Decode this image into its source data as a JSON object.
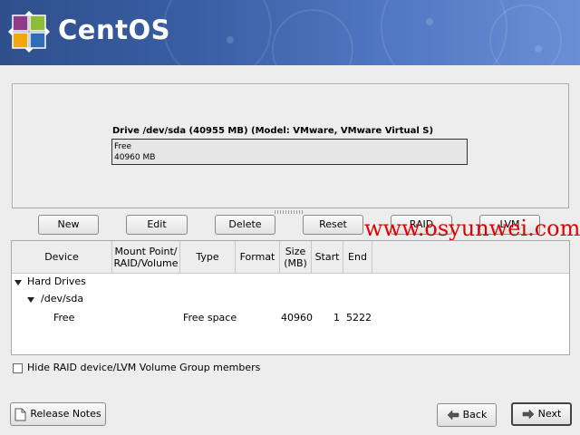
{
  "header": {
    "brand": "CentOS",
    "colors": {
      "banner": "#3a5fa5",
      "logo_green": "#8bbd3a",
      "logo_purple": "#8e3b8c",
      "logo_orange": "#f2a70f",
      "logo_blue": "#2f6db5"
    }
  },
  "drive": {
    "label": "Drive /dev/sda (40955 MB) (Model: VMware, VMware Virtual S)",
    "segment_name": "Free",
    "segment_size": "40960 MB"
  },
  "buttons": {
    "new": "New",
    "edit": "Edit",
    "delete": "Delete",
    "reset": "Reset",
    "raid": "RAID",
    "lvm": "LVM"
  },
  "watermark": "www.osyunwei.com",
  "table": {
    "columns": [
      "Device",
      "Mount Point/ RAID/Volume",
      "Type",
      "Format",
      "Size (MB)",
      "Start",
      "End"
    ],
    "columns_display": {
      "device": "Device",
      "mount_line1": "Mount Point/",
      "mount_line2": "RAID/Volume",
      "type": "Type",
      "format": "Format",
      "size_line1": "Size",
      "size_line2": "(MB)",
      "start": "Start",
      "end": "End"
    },
    "tree": {
      "group": "Hard Drives",
      "drive": "/dev/sda",
      "rows": [
        {
          "device": "Free",
          "mount": "",
          "type": "Free space",
          "format": "",
          "size": "40960",
          "start": "1",
          "end": "5222"
        }
      ]
    }
  },
  "options": {
    "hide_raid_label": "Hide RAID device/LVM Volume Group members",
    "hide_raid_checked": false
  },
  "footer": {
    "release_notes": "Release Notes",
    "back": "Back",
    "next": "Next"
  }
}
